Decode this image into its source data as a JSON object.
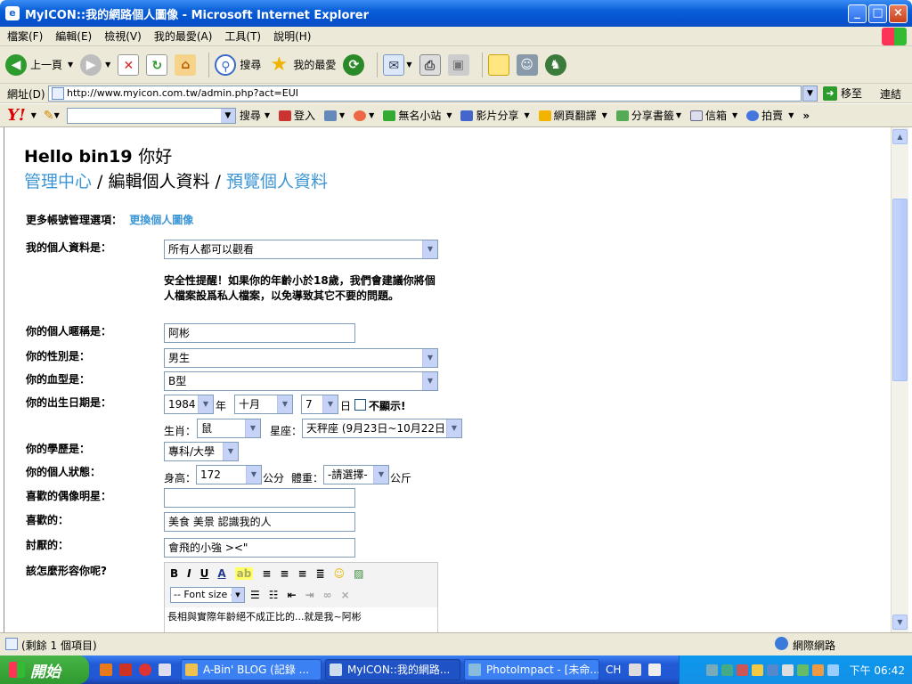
{
  "window": {
    "title": "MyICON::我的網路個人圖像 - Microsoft Internet Explorer"
  },
  "menu": [
    "檔案(F)",
    "編輯(E)",
    "檢視(V)",
    "我的最愛(A)",
    "工具(T)",
    "說明(H)"
  ],
  "toolbar": {
    "back": "上一頁",
    "search": "搜尋",
    "favorites": "我的最愛"
  },
  "address": {
    "label": "網址(D)",
    "url": "http://www.myicon.com.tw/admin.php?act=EUI",
    "go": "移至",
    "links": "連結"
  },
  "yahoo": {
    "logo": "Y!",
    "search_btn": "搜尋",
    "login": "登入",
    "items": [
      "無名小站",
      "影片分享",
      "網頁翻譯",
      "分享書籤",
      "信箱",
      "拍賣"
    ]
  },
  "page": {
    "hello": "Hello bin19",
    "hello_suffix": "你好",
    "crumb_admin": "管理中心",
    "crumb_sep1": " / ",
    "crumb_edit": "編輯個人資料",
    "crumb_sep2": " / ",
    "crumb_preview": "預覽個人資料",
    "more_options_label": "更多帳號管理選項：",
    "more_options_link": "更換個人圖像",
    "privacy_label": "我的個人資料是：",
    "privacy_value": "所有人都可以觀看",
    "warning": "安全性提醒！如果你的年齡小於18歲，我們會建議你將個人檔案設爲私人檔案，以免導致其它不要的問題。",
    "nickname_label": "你的個人暱稱是：",
    "nickname_value": "阿彬",
    "gender_label": "你的性別是：",
    "gender_value": "男生",
    "blood_label": "你的血型是：",
    "blood_value": "B型",
    "birthday_label": "你的出生日期是：",
    "birth_year": "1984",
    "year_unit": "年",
    "birth_month": "十月",
    "birth_day": "7",
    "day_unit": "日",
    "hide_label": "不顯示!",
    "zodiac_label": "生肖：",
    "zodiac_value": "鼠",
    "star_label": "星座：",
    "star_value": "天秤座 (9月23日~10月22日)",
    "education_label": "你的學歷是：",
    "education_value": "專科/大學",
    "status_label": "你的個人狀態：",
    "height_label": "身高：",
    "height_value": "172",
    "height_unit": "公分",
    "weight_label": "體重：",
    "weight_value": "-請選擇-",
    "weight_unit": "公斤",
    "idol_label": "喜歡的偶像明星：",
    "idol_value": "",
    "likes_label": "喜歡的：",
    "likes_value": "美食 美景 認識我的人",
    "dislikes_label": "討厭的：",
    "dislikes_value": "會飛的小強 ><\"",
    "describe_label": "該怎麼形容你呢?",
    "editor_fontsize": "-- Font size --",
    "editor_content": "長相與實際年齡絕不成正比的...就是我~阿彬"
  },
  "status": {
    "left": "(剩餘 1 個項目)",
    "zone": "網際網路"
  },
  "taskbar": {
    "start": "開始",
    "tasks": [
      "A-Bin' BLOG (記錄 ...",
      "MyICON::我的網路...",
      "PhotoImpact - [未命..."
    ],
    "lang": "CH",
    "clock": "下午 06:42"
  }
}
